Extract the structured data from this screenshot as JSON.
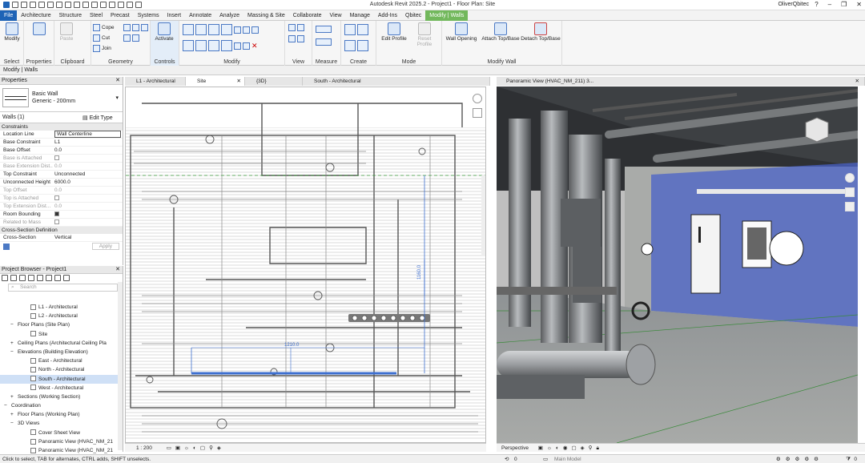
{
  "window": {
    "title": "Autodesk Revit 2025.2 - Project1 - Floor Plan: Site",
    "user": "OliverQbitec"
  },
  "tabs": [
    "File",
    "Architecture",
    "Structure",
    "Steel",
    "Precast",
    "Systems",
    "Insert",
    "Annotate",
    "Analyze",
    "Massing & Site",
    "Collaborate",
    "View",
    "Manage",
    "Add-Ins",
    "Qbitec",
    "Modify | Walls"
  ],
  "ribbon": {
    "select": {
      "modify": "Modify",
      "label": "Select"
    },
    "properties": {
      "label": "Properties"
    },
    "clipboard": {
      "paste": "Paste",
      "cope": "Cope",
      "cut": "Cut",
      "join": "Join",
      "label": "Clipboard"
    },
    "geometry": {
      "label": "Geometry"
    },
    "controls": {
      "activate": "Activate",
      "label": "Controls"
    },
    "modify": {
      "label": "Modify"
    },
    "view": {
      "label": "View"
    },
    "measure": {
      "label": "Measure"
    },
    "create": {
      "label": "Create"
    },
    "mode": {
      "edit_profile": "Edit Profile",
      "reset_profile": "Reset Profile",
      "label": "Mode"
    },
    "modify_wall": {
      "wall_opening": "Wall Opening",
      "attach": "Attach Top/Base",
      "detach": "Detach Top/Base",
      "label": "Modify Wall"
    }
  },
  "context_label": "Modify | Walls",
  "properties": {
    "header": "Properties",
    "type_name": "Basic Wall",
    "type_sub": "Generic - 200mm",
    "selector": "Walls (1)",
    "edit_type": "Edit Type",
    "section_constraints": "Constraints",
    "rows": [
      {
        "k": "Location Line",
        "v": "Wall Centerline",
        "dim": false
      },
      {
        "k": "Base Constraint",
        "v": "L1",
        "dim": false
      },
      {
        "k": "Base Offset",
        "v": "0.0",
        "dim": false
      },
      {
        "k": "Base is Attached",
        "v": "",
        "dim": true
      },
      {
        "k": "Base Extension Dist...",
        "v": "0.0",
        "dim": true
      },
      {
        "k": "Top Constraint",
        "v": "Unconnected",
        "dim": false
      },
      {
        "k": "Unconnected Height",
        "v": "6000.0",
        "dim": false
      },
      {
        "k": "Top Offset",
        "v": "0.0",
        "dim": true
      },
      {
        "k": "Top is Attached",
        "v": "",
        "dim": true
      },
      {
        "k": "Top Extension Dist...",
        "v": "0.0",
        "dim": true
      },
      {
        "k": "Room Bounding",
        "v": "",
        "dim": false
      },
      {
        "k": "Related to Mass",
        "v": "",
        "dim": true
      }
    ],
    "section_cross": "Cross-Section Definition",
    "cross_row": {
      "k": "Cross-Section",
      "v": "Vertical"
    },
    "apply": "Apply"
  },
  "browser": {
    "header": "Project Browser - Project1",
    "search_placeholder": "Search",
    "items": [
      {
        "label": "L1 - Architectural",
        "indent": 38,
        "icon": true
      },
      {
        "label": "L2 - Architectural",
        "indent": 38,
        "icon": true
      },
      {
        "label": "Floor Plans (Site Plan)",
        "indent": 22,
        "icon": false,
        "exp": "−"
      },
      {
        "label": "Site",
        "indent": 38,
        "icon": true
      },
      {
        "label": "Ceiling Plans (Architectural Ceiling Pla",
        "indent": 22,
        "icon": false,
        "exp": "+"
      },
      {
        "label": "Elevations (Building Elevation)",
        "indent": 22,
        "icon": false,
        "exp": "−"
      },
      {
        "label": "East - Architectural",
        "indent": 38,
        "icon": true
      },
      {
        "label": "North - Architectural",
        "indent": 38,
        "icon": true
      },
      {
        "label": "South - Architectural",
        "indent": 38,
        "icon": true,
        "sel": true
      },
      {
        "label": "West - Architectural",
        "indent": 38,
        "icon": true
      },
      {
        "label": "Sections (Working Section)",
        "indent": 22,
        "icon": false,
        "exp": "+"
      },
      {
        "label": "Coordination",
        "indent": 14,
        "icon": false,
        "exp": "−"
      },
      {
        "label": "Floor Plans (Working Plan)",
        "indent": 22,
        "icon": false,
        "exp": "+"
      },
      {
        "label": "3D Views",
        "indent": 22,
        "icon": false,
        "exp": "−"
      },
      {
        "label": "Cover Sheet View",
        "indent": 38,
        "icon": true
      },
      {
        "label": "Panoramic View (HVAC_NM_21",
        "indent": 38,
        "icon": true
      },
      {
        "label": "Panoramic View (HVAC_NM_21",
        "indent": 38,
        "icon": true
      }
    ]
  },
  "view_tabs": [
    "L1 - Architectural",
    "Site",
    "{3D}",
    "South - Architectural"
  ],
  "pano_title": "Panoramic View (HVAC_NM_211) 3...",
  "plan": {
    "scale": "1 : 200",
    "dim1": "1160.0",
    "dim2": "1210.0"
  },
  "pano": {
    "mode": "Perspective"
  },
  "status": {
    "text": "Click to select, TAB for alternates, CTRL adds, SHIFT unselects.",
    "zero": "0",
    "model": "Main Model"
  }
}
